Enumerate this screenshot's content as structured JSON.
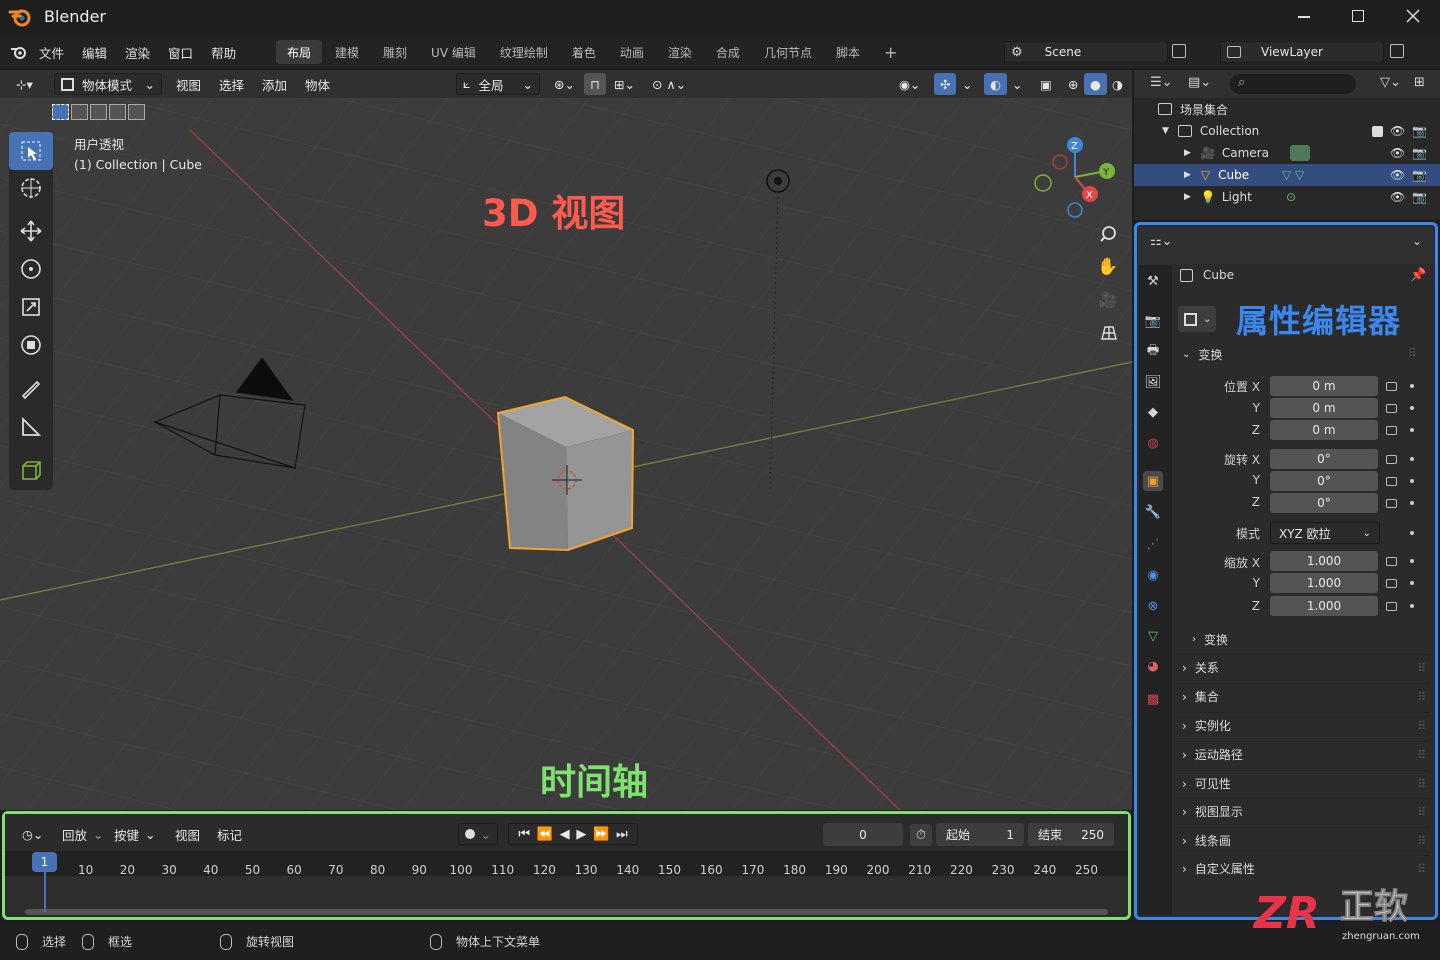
{
  "window": {
    "title": "Blender"
  },
  "menu": [
    "文件",
    "编辑",
    "渲染",
    "窗口",
    "帮助"
  ],
  "workspaces": [
    "布局",
    "建模",
    "雕刻",
    "UV 编辑",
    "纹理绘制",
    "着色",
    "动画",
    "渲染",
    "合成",
    "几何节点",
    "脚本"
  ],
  "scene": "Scene",
  "viewlayer": "ViewLayer",
  "viewport_header": {
    "mode": "物体模式",
    "view": "视图",
    "select": "选择",
    "add": "添加",
    "object": "物体",
    "transform": "全局"
  },
  "viewport": {
    "persp": "用户透视",
    "collection_info": "(1) Collection | Cube",
    "overlay_label": "3D 视图"
  },
  "timeline": {
    "overlay_label": "时间轴",
    "playback": "回放",
    "keying": "按键",
    "view": "视图",
    "marker": "标记",
    "current_frame": "0",
    "start_label": "起始",
    "start": "1",
    "end_label": "结束",
    "end": "250",
    "frame_marker": "1",
    "ticks": [
      "10",
      "20",
      "30",
      "40",
      "50",
      "60",
      "70",
      "80",
      "90",
      "100",
      "110",
      "120",
      "130",
      "140",
      "150",
      "160",
      "170",
      "180",
      "190",
      "200",
      "210",
      "220",
      "230",
      "240",
      "250"
    ]
  },
  "outliner": {
    "scene_collection": "场景集合",
    "collection": "Collection",
    "items": [
      "Camera",
      "Cube",
      "Light"
    ]
  },
  "properties": {
    "overlay_label": "属性编辑器",
    "object_name": "Cube",
    "transform_section": "变换",
    "location_label": "位置 X",
    "rotation_label": "旋转 X",
    "scale_label": "缩放 X",
    "y_label": "Y",
    "z_label": "Z",
    "location": [
      "0 m",
      "0 m",
      "0 m"
    ],
    "rotation": [
      "0°",
      "0°",
      "0°"
    ],
    "mode_label": "模式",
    "mode_value": "XYZ 欧拉",
    "scale": [
      "1.000",
      "1.000",
      "1.000"
    ],
    "delta_transform": "变换",
    "sections": [
      "关系",
      "集合",
      "实例化",
      "运动路径",
      "可见性",
      "视图显示",
      "线条画",
      "自定义属性"
    ]
  },
  "status": {
    "select": "选择",
    "box_select": "框选",
    "rotate_view": "旋转视图",
    "context_menu": "物体上下文菜单"
  },
  "watermark": {
    "logo": "ZR",
    "brand": "正软",
    "url": "zhengruan.com"
  },
  "colors": {
    "selection": "#4772b3",
    "timeline_border": "#7ee36e",
    "props_border": "#3a87f0",
    "viewport_label": "#ff5a4e",
    "timeline_label": "#7ee36e",
    "props_label": "#3a87f0",
    "cube_outline": "#f5a32a"
  }
}
